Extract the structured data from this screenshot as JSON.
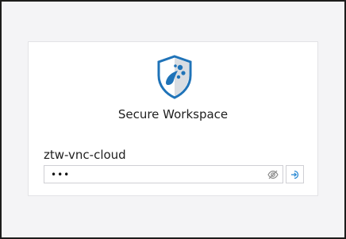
{
  "login": {
    "product_title": "Secure Workspace",
    "host_name": "ztw-vnc-cloud",
    "password_value": "•••"
  },
  "icons": {
    "logo": "shield-splash-logo",
    "reveal": "eye-slash-icon",
    "submit": "sign-in-arrow-icon"
  },
  "colors": {
    "brand_blue": "#1f73b8",
    "accent_blue": "#2a8ad4"
  }
}
